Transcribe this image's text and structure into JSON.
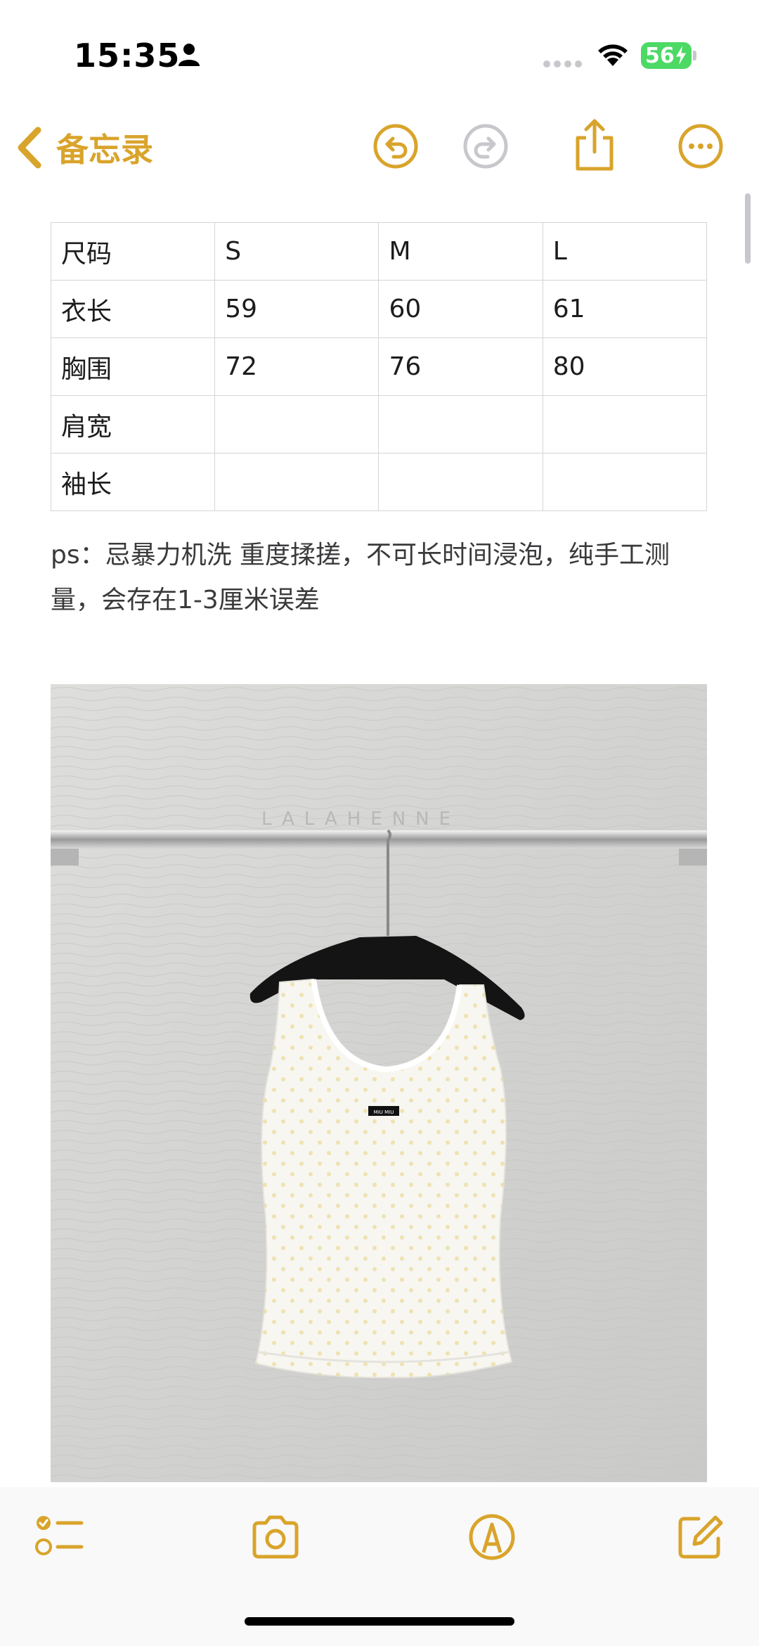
{
  "status_bar": {
    "time": "15:35",
    "battery_level": "56"
  },
  "nav": {
    "back_label": "备忘录"
  },
  "size_table": {
    "rows": [
      [
        "尺码",
        "S",
        "M",
        "L"
      ],
      [
        "衣长",
        "59",
        "60",
        "61"
      ],
      [
        "胸围",
        "72",
        "76",
        "80"
      ],
      [
        "肩宽",
        "",
        "",
        ""
      ],
      [
        "袖长",
        "",
        "",
        ""
      ]
    ]
  },
  "note": {
    "text": "ps：忌暴力机洗 重度揉搓，不可长时间浸泡，纯手工测量，会存在1-3厘米误差"
  },
  "photo": {
    "watermark": "LALAHENNE",
    "label_text": "MIU MIU"
  },
  "colors": {
    "accent": "#d9a42b",
    "battery": "#4cd964",
    "wall": "#d4d4d2"
  }
}
